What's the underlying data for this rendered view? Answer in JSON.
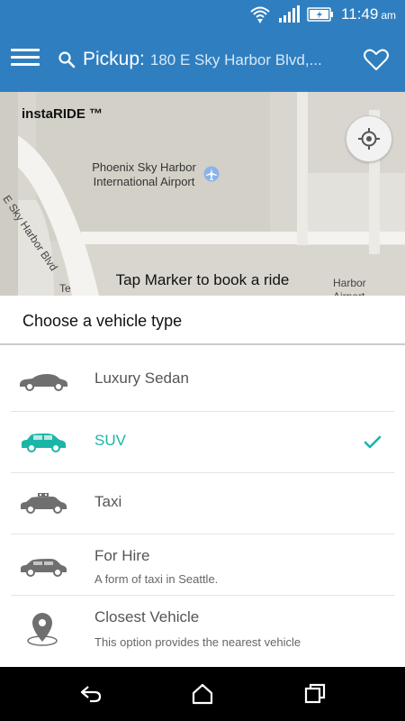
{
  "status_bar": {
    "time": "11:49",
    "ampm": "am"
  },
  "app_bar": {
    "pickup_label": "Pickup:",
    "pickup_value": "180 E Sky Harbor Blvd,..."
  },
  "map": {
    "brand": "instaRIDE ™",
    "airport_label": "Phoenix Sky Harbor International Airport",
    "road_label": "E Sky Harbor Blvd",
    "hint": "Tap Marker to book a ride",
    "partial_left": "Te",
    "partial_right": "Harbor Airport"
  },
  "sheet": {
    "title": "Choose a vehicle type",
    "vehicles": [
      {
        "label": "Luxury Sedan",
        "icon": "luxury-sedan-icon",
        "selected": false
      },
      {
        "label": "SUV",
        "icon": "suv-icon",
        "selected": true
      },
      {
        "label": "Taxi",
        "icon": "taxi-icon",
        "selected": false
      },
      {
        "label": "For Hire",
        "sub": "A form of taxi in Seattle.",
        "icon": "sedan-icon",
        "selected": false
      },
      {
        "label": "Closest Vehicle",
        "sub": "This option provides the nearest vehicle",
        "icon": "location-pin-icon",
        "selected": false
      }
    ]
  },
  "colors": {
    "app_bar": "#2f7fc0",
    "accent": "#1bb5a6",
    "icon_gray": "#6f6f6f"
  }
}
